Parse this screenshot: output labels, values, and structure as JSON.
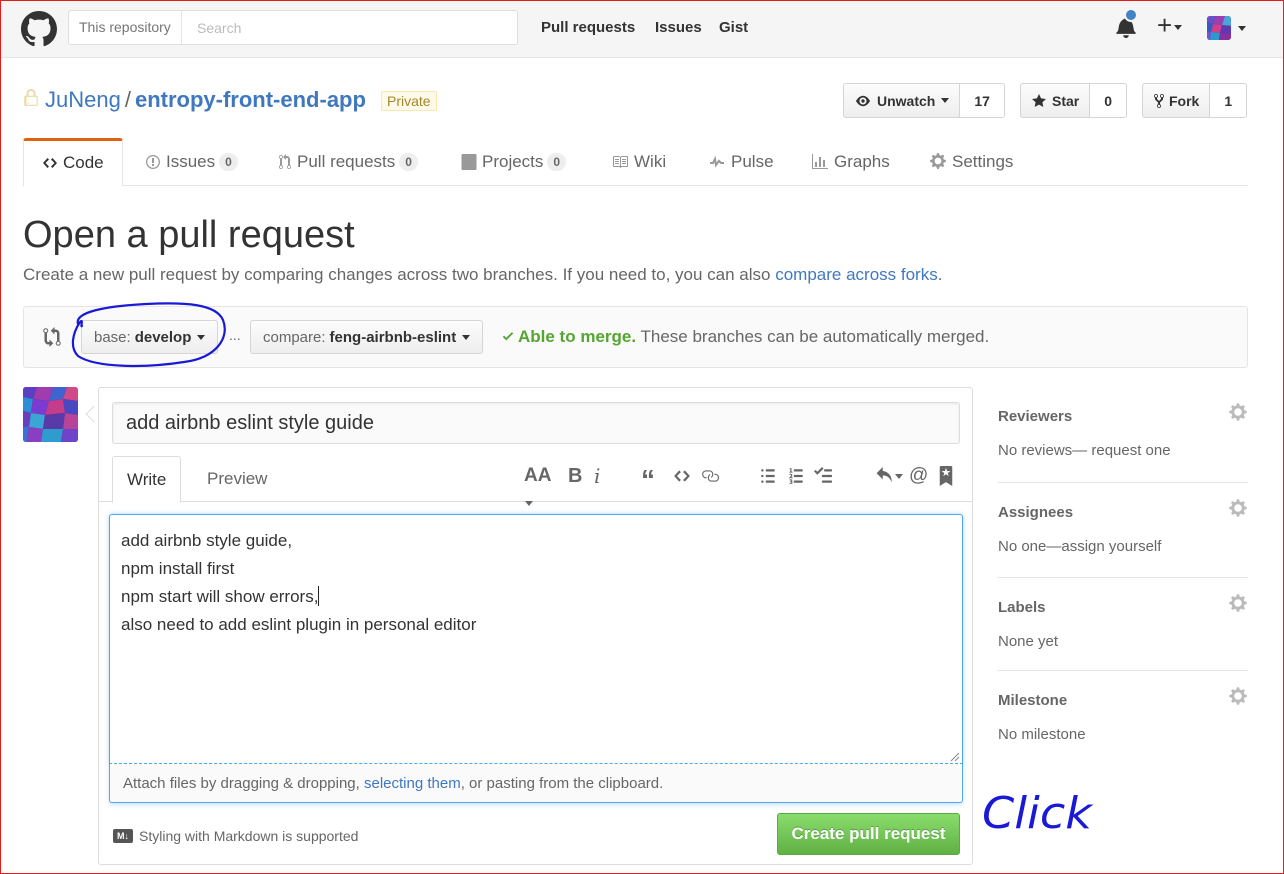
{
  "header": {
    "search_scope": "This repository",
    "search_placeholder": "Search",
    "nav": [
      "Pull requests",
      "Issues",
      "Gist"
    ]
  },
  "repo": {
    "owner": "JuNeng",
    "separator": "/",
    "name": "entropy-front-end-app",
    "visibility": "Private",
    "watch_label": "Unwatch",
    "watch_count": "17",
    "star_label": "Star",
    "star_count": "0",
    "fork_label": "Fork",
    "fork_count": "1"
  },
  "tabs": {
    "code": "Code",
    "issues": "Issues",
    "issues_count": "0",
    "pulls": "Pull requests",
    "pulls_count": "0",
    "projects": "Projects",
    "projects_count": "0",
    "wiki": "Wiki",
    "pulse": "Pulse",
    "graphs": "Graphs",
    "settings": "Settings"
  },
  "page": {
    "title": "Open a pull request",
    "description": "Create a new pull request by comparing changes across two branches. If you need to, you can also ",
    "description_link": "compare across forks",
    "description_end": "."
  },
  "compare": {
    "base_label": "base:",
    "base_value": "develop",
    "dots": "...",
    "compare_label": "compare:",
    "compare_value": "feng-airbnb-eslint",
    "merge_status": "Able to merge.",
    "merge_message": " These branches can be automatically merged."
  },
  "form": {
    "title_value": "add airbnb eslint style guide",
    "tab_write": "Write",
    "tab_preview": "Preview",
    "body_lines": [
      "add airbnb style guide,",
      "npm install first",
      "npm start will show errors,",
      "also need to add eslint plugin in personal editor"
    ],
    "attach_before": "Attach files by dragging & dropping, ",
    "attach_link": "selecting them",
    "attach_after": ", or pasting from the clipboard.",
    "markdown_note": "Styling with Markdown is supported",
    "markdown_badge": "M↓",
    "submit_label": "Create pull request"
  },
  "sidebar": {
    "reviewers_title": "Reviewers",
    "reviewers_value": "No reviews— request one",
    "assignees_title": "Assignees",
    "assignees_value": "No one—assign yourself",
    "labels_title": "Labels",
    "labels_value": "None yet",
    "milestone_title": "Milestone",
    "milestone_value": "No milestone"
  },
  "annotations": {
    "click_note": "Click"
  },
  "colors": {
    "link": "#4078c0",
    "accent_tab": "#e36209",
    "success": "#55a532",
    "button_green": "#60b044",
    "annotation_ink": "#1a1ad6",
    "notification_dot": "#4183c4"
  },
  "icons": [
    "github-logo-icon",
    "bell-icon",
    "plus-icon",
    "lock-icon",
    "eye-icon",
    "star-icon",
    "fork-icon",
    "code-icon",
    "issue-icon",
    "pull-request-icon",
    "project-icon",
    "book-icon",
    "pulse-icon",
    "graph-icon",
    "gear-icon",
    "compare-icon",
    "check-icon",
    "markdown-icon"
  ]
}
